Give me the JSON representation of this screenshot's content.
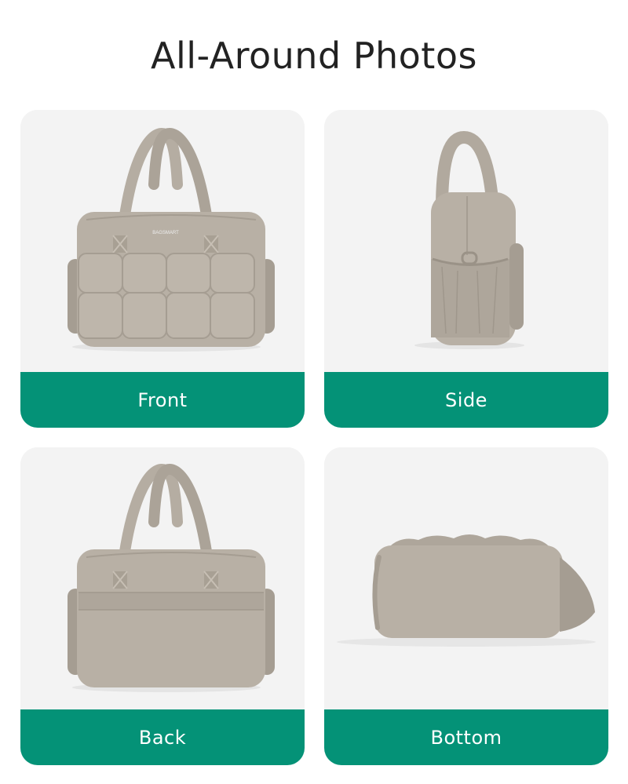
{
  "title": "All-Around Photos",
  "brand_text": "BAGSMART",
  "colors": {
    "accent": "#049277",
    "card_bg": "#f3f3f3",
    "bag": "#b8b0a5",
    "bag_shadow": "#a59d92",
    "bag_light": "#c7bfb4"
  },
  "views": [
    {
      "label": "Front"
    },
    {
      "label": "Side"
    },
    {
      "label": "Back"
    },
    {
      "label": "Bottom"
    }
  ]
}
